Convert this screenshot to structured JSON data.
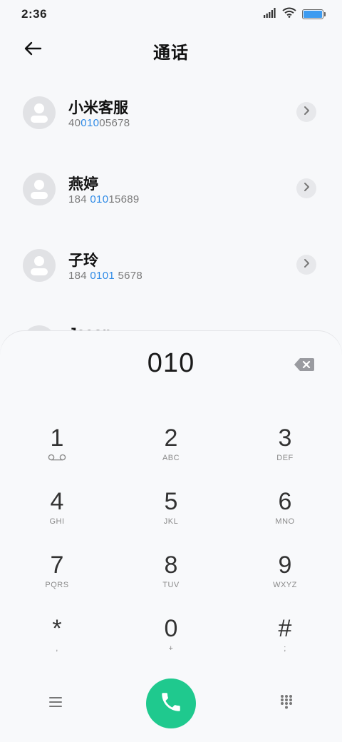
{
  "status_bar": {
    "time": "2:36",
    "battery_level": 1.0,
    "icons": [
      "signal-icon",
      "wifi-icon",
      "battery-icon"
    ]
  },
  "header": {
    "title": "通话",
    "back_icon": "arrow-left-icon"
  },
  "contacts": [
    {
      "name": "小米客服",
      "number_before": "40",
      "number_match": "010",
      "number_after": "05678"
    },
    {
      "name": "燕婷",
      "number_before": "184 ",
      "number_match": "010",
      "number_after": "15689"
    },
    {
      "name": "子玲",
      "number_before": "184 ",
      "number_match": "0101",
      "number_after": " 5678"
    },
    {
      "name": "Jason",
      "number_before": "",
      "number_match": "",
      "number_after": ""
    }
  ],
  "dialer": {
    "display": "010",
    "keys": [
      {
        "digit": "1",
        "letters": ""
      },
      {
        "digit": "2",
        "letters": "ABC"
      },
      {
        "digit": "3",
        "letters": "DEF"
      },
      {
        "digit": "4",
        "letters": "GHI"
      },
      {
        "digit": "5",
        "letters": "JKL"
      },
      {
        "digit": "6",
        "letters": "MNO"
      },
      {
        "digit": "7",
        "letters": "PQRS"
      },
      {
        "digit": "8",
        "letters": "TUV"
      },
      {
        "digit": "9",
        "letters": "WXYZ"
      },
      {
        "digit": "*",
        "letters": ","
      },
      {
        "digit": "0",
        "letters": "+"
      },
      {
        "digit": "#",
        "letters": ";"
      }
    ],
    "bottom_icons": [
      "menu-icon",
      "phone-icon",
      "dialpad-icon"
    ]
  },
  "colors": {
    "accent_blue": "#2e8ae6",
    "call_green": "#1fc98e",
    "background": "#f7f8fa"
  }
}
